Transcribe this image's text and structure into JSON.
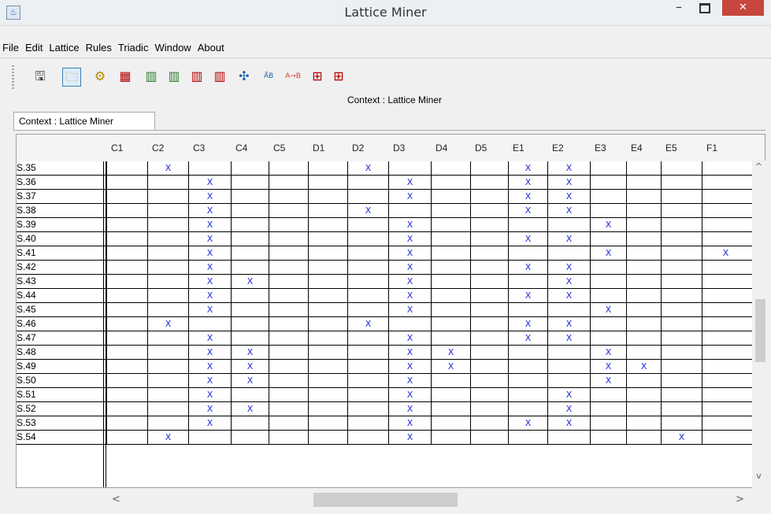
{
  "window": {
    "title": "Lattice Miner",
    "minimize": "–",
    "close": "✕"
  },
  "menu": [
    "File",
    "Edit",
    "Lattice",
    "Rules",
    "Triadic",
    "Window",
    "About"
  ],
  "toolbar": {
    "icons": [
      {
        "name": "save-icon",
        "glyph": "🖫",
        "color": "#444444"
      },
      {
        "name": "open-folder-icon",
        "glyph": "🗀",
        "color": "#c9a227"
      },
      {
        "name": "settings-gear-icon",
        "glyph": "⚙",
        "color": "#b58a00"
      },
      {
        "name": "context-edit-icon",
        "glyph": "▦",
        "color": "#b00000"
      },
      {
        "name": "add-row-icon",
        "glyph": "▥",
        "color": "#2e7d32"
      },
      {
        "name": "add-column-icon",
        "glyph": "▥",
        "color": "#2e7d32"
      },
      {
        "name": "delete-row-icon",
        "glyph": "▥",
        "color": "#b00000"
      },
      {
        "name": "delete-column-icon",
        "glyph": "▥",
        "color": "#b00000"
      },
      {
        "name": "lattice-icon",
        "glyph": "✣",
        "color": "#1f5fa8"
      },
      {
        "name": "ab-rules-icon",
        "glyph": "A⃗B",
        "color": "#1f5fa8"
      },
      {
        "name": "association-rules-icon",
        "glyph": "A→B",
        "color": "#d04040"
      },
      {
        "name": "grid-icon",
        "glyph": "⊞",
        "color": "#b00000"
      },
      {
        "name": "table-icon",
        "glyph": "⊞",
        "color": "#b00000"
      }
    ]
  },
  "context_label": "Context : Lattice Miner",
  "tab_label": "Context : Lattice Miner",
  "columns": [
    "C1",
    "C2",
    "C3",
    "C4",
    "C5",
    "D1",
    "D2",
    "D3",
    "D4",
    "D5",
    "E1",
    "E2",
    "E3",
    "E4",
    "E5",
    "F1"
  ],
  "rows": [
    {
      "label": "S.35",
      "x": [
        "C2",
        "D2",
        "E1",
        "E2"
      ]
    },
    {
      "label": "S.36",
      "x": [
        "C3",
        "D3",
        "E1",
        "E2"
      ]
    },
    {
      "label": "S.37",
      "x": [
        "C3",
        "D3",
        "E1",
        "E2"
      ]
    },
    {
      "label": "S.38",
      "x": [
        "C3",
        "D2",
        "E1",
        "E2"
      ]
    },
    {
      "label": "S.39",
      "x": [
        "C3",
        "D3",
        "E3"
      ]
    },
    {
      "label": "S.40",
      "x": [
        "C3",
        "D3",
        "E1",
        "E2"
      ]
    },
    {
      "label": "S.41",
      "x": [
        "C3",
        "D3",
        "E3",
        "F1"
      ]
    },
    {
      "label": "S.42",
      "x": [
        "C3",
        "D3",
        "E1",
        "E2"
      ]
    },
    {
      "label": "S.43",
      "x": [
        "C3",
        "C4",
        "D3",
        "E2"
      ]
    },
    {
      "label": "S.44",
      "x": [
        "C3",
        "D3",
        "E1",
        "E2"
      ]
    },
    {
      "label": "S.45",
      "x": [
        "C3",
        "D3",
        "E3"
      ]
    },
    {
      "label": "S.46",
      "x": [
        "C2",
        "D2",
        "E1",
        "E2"
      ]
    },
    {
      "label": "S.47",
      "x": [
        "C3",
        "D3",
        "E1",
        "E2"
      ]
    },
    {
      "label": "S.48",
      "x": [
        "C3",
        "C4",
        "D3",
        "D4",
        "E3"
      ]
    },
    {
      "label": "S.49",
      "x": [
        "C3",
        "C4",
        "D3",
        "D4",
        "E3",
        "E4"
      ]
    },
    {
      "label": "S.50",
      "x": [
        "C3",
        "C4",
        "D3",
        "E3"
      ]
    },
    {
      "label": "S.51",
      "x": [
        "C3",
        "D3",
        "E2"
      ]
    },
    {
      "label": "S.52",
      "x": [
        "C3",
        "C4",
        "D3",
        "E2"
      ]
    },
    {
      "label": "S.53",
      "x": [
        "C3",
        "D3",
        "E1",
        "E2"
      ]
    },
    {
      "label": "S.54",
      "x": [
        "C2",
        "D3",
        "E5"
      ]
    }
  ],
  "mark": "X",
  "scrollbar": {
    "up": "^",
    "down": "v",
    "left": "<",
    "right": ">"
  }
}
